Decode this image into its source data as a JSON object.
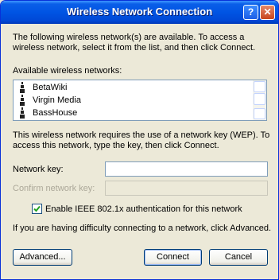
{
  "window": {
    "title": "Wireless Network Connection",
    "help_label": "?",
    "close_label": "✕"
  },
  "intro": {
    "line1": "The following wireless network(s) are available. To access a",
    "line2": "wireless network, select it from the list, and then click Connect."
  },
  "networks": {
    "label": "Available wireless networks:",
    "items": [
      {
        "name": "BetaWiki",
        "icon": "antenna-icon"
      },
      {
        "name": "Virgin Media",
        "icon": "antenna-icon"
      },
      {
        "name": "BassHouse",
        "icon": "antenna-icon"
      }
    ]
  },
  "wep": {
    "line1": "This wireless network requires the use of a network key (WEP). To",
    "line2": "access this network, type the key, then click Connect."
  },
  "form": {
    "network_key_label": "Network key:",
    "network_key_value": "",
    "confirm_key_label": "Confirm network key:",
    "confirm_key_value": ""
  },
  "ieee": {
    "label": "Enable IEEE 802.1x authentication for this network",
    "checked": true
  },
  "advanced_note": "If you are having difficulty connecting to a network, click Advanced.",
  "buttons": {
    "advanced": "Advanced...",
    "connect": "Connect",
    "cancel": "Cancel"
  }
}
